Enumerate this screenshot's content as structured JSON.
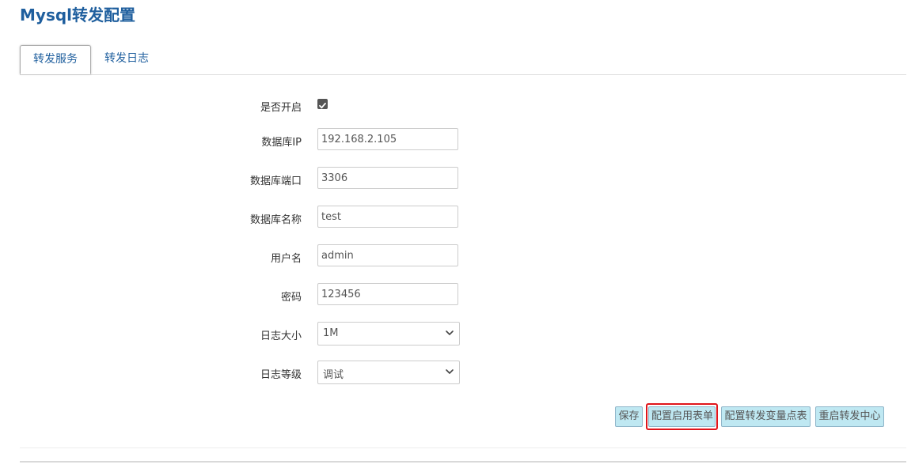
{
  "page": {
    "title": "Mysql转发配置"
  },
  "tabs": [
    {
      "label": "转发服务",
      "active": true
    },
    {
      "label": "转发日志",
      "active": false
    }
  ],
  "form": {
    "enable": {
      "label": "是否开启",
      "checked": true
    },
    "db_ip": {
      "label": "数据库IP",
      "value": "192.168.2.105"
    },
    "db_port": {
      "label": "数据库端口",
      "value": "3306"
    },
    "db_name": {
      "label": "数据库名称",
      "value": "test"
    },
    "username": {
      "label": "用户名",
      "value": "admin"
    },
    "password": {
      "label": "密码",
      "value": "123456"
    },
    "log_size": {
      "label": "日志大小",
      "value": "1M"
    },
    "log_level": {
      "label": "日志等级",
      "value": "调试"
    }
  },
  "buttons": {
    "save": "保存",
    "config_enable_table": "配置启用表单",
    "config_var_points": "配置转发变量点表",
    "restart_center": "重启转发中心"
  },
  "colors": {
    "title": "#1f5f9e",
    "button_bg": "#bfe8f2",
    "highlight": "#e0151b"
  }
}
